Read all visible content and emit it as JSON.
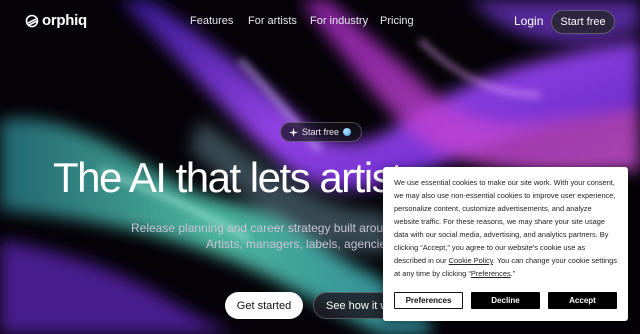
{
  "brand": {
    "name": "orphiq"
  },
  "nav": {
    "links": [
      "Features",
      "For artists",
      "For industry",
      "Pricing"
    ],
    "login": "Login",
    "start_free": "Start free"
  },
  "hero": {
    "pill_label": "Start free",
    "headline": "The AI that lets artist",
    "subtitle_line1": "Release planning and career strategy built around r",
    "subtitle_line2": "Artists, managers, labels, agencies, ",
    "cta_primary": "Get started",
    "cta_secondary": "See how it w"
  },
  "cookie_banner": {
    "text_before_policy": "We use essential cookies to make our site work. With your consent, we may also use non-essential cookies to improve user experience, personalize content, customize advertisements, and analyze website traffic. For these reasons, we may share your site usage data with our social media, advertising, and analytics partners. By clicking “Accept,” you agree to our website's cookie use as described in our ",
    "policy_link": "Cookie Policy",
    "text_middle": ". You can change your cookie settings at any time by clicking “",
    "preferences_link": "Preferences",
    "text_end": ".”",
    "preferences_button": "Preferences",
    "decline_button": "Decline",
    "accept_button": "Accept"
  },
  "colors": {
    "background": "#050308",
    "ribbon_purple": "#8a3df0",
    "ribbon_teal": "#4fd6c0",
    "ribbon_magenta": "#d43ad8",
    "cta_white": "#ffffff"
  }
}
